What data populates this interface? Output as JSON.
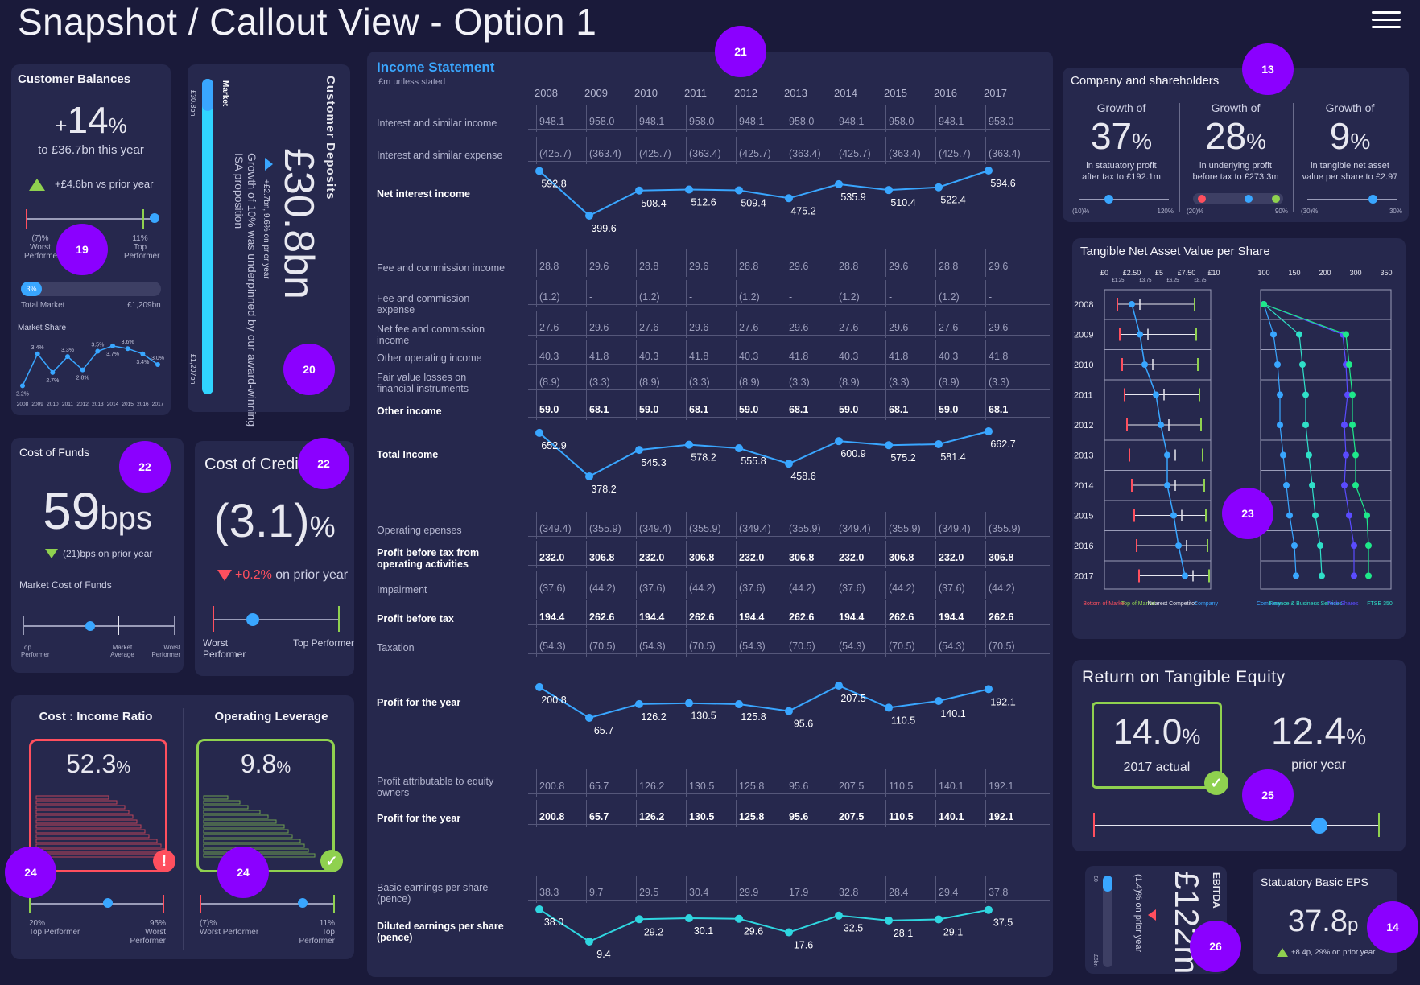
{
  "page": {
    "title": "Snapshot / Callout View - Option 1"
  },
  "markers": {
    "m21": "21",
    "m13": "13",
    "m19": "19",
    "m20": "20",
    "m22a": "22",
    "m22b": "22",
    "m23": "23",
    "m24a": "24",
    "m24b": "24",
    "m25": "25",
    "m26": "26",
    "m14": "14"
  },
  "customer_balances": {
    "title": "Customer Balances",
    "growth_sign": "+",
    "growth_value": "14",
    "growth_unit": "%",
    "subtitle": "to £36.7bn this year",
    "vs_prior": "+£4.6bn vs prior year",
    "gauge_left": "(7)%",
    "gauge_left_label": "Worst Performer",
    "gauge_right": "11%",
    "gauge_right_label": "Top Performer",
    "share_pct": "3%",
    "share_left": "Total Market",
    "share_right": "£1,209bn",
    "market_share_title": "Market Share",
    "market_share": {
      "years": [
        "2008",
        "2009",
        "2010",
        "2011",
        "2012",
        "2013",
        "2014",
        "2015",
        "2016",
        "2017"
      ],
      "values": [
        2.2,
        3.4,
        2.7,
        3.3,
        2.8,
        3.5,
        3.7,
        3.6,
        3.4,
        3.0
      ],
      "labels": [
        "2.2%",
        "3.4%",
        "2.7%",
        "3.3%",
        "2.8%",
        "3.5%",
        "3.7%",
        "3.6%",
        "3.4%",
        "3.0%"
      ]
    }
  },
  "customer_deposits": {
    "title": "Customer Deposits",
    "value": "£30.8bn",
    "change": "+£2.7bn, 9.6% on prior year",
    "narrative": "Growth of 10% was underpinned by our award-winning ISA proposition",
    "bar_label": "Market",
    "bar_top": "£30.8bn",
    "bar_bottom": "£1,207bn"
  },
  "cost_of_funds": {
    "title": "Cost of Funds",
    "value": "59",
    "unit": "bps",
    "change": "(21)bps on prior year",
    "subtitle": "Market Cost of Funds",
    "left_label": "Top Performer",
    "mid_label": "Market Average",
    "right_label": "Worst Performer"
  },
  "cost_of_credit": {
    "title": "Cost of Credit",
    "value": "(3.1)",
    "unit": "%",
    "change_value": "+0.2%",
    "change_text": "on prior year",
    "left_label": "Worst Performer",
    "right_label": "Top Performer"
  },
  "cost_income": {
    "title": "Cost : Income Ratio",
    "value": "52.3",
    "unit": "%",
    "left": "20%",
    "left_label": "Top Performer",
    "right": "95%",
    "right_label": "Worst Performer"
  },
  "operating_leverage": {
    "title": "Operating Leverage",
    "value": "9.8",
    "unit": "%",
    "left": "(7)%",
    "left_label": "Worst Performer",
    "right": "11%",
    "right_label": "Top Performer"
  },
  "income_statement": {
    "title": "Income Statement",
    "subtitle": "£m unless stated",
    "years": [
      "2008",
      "2009",
      "2010",
      "2011",
      "2012",
      "2013",
      "2014",
      "2015",
      "2016",
      "2017"
    ],
    "rows": [
      {
        "label": "Interest and similar income",
        "bold": false,
        "values": [
          "948.1",
          "958.0",
          "948.1",
          "958.0",
          "948.1",
          "958.0",
          "948.1",
          "958.0",
          "948.1",
          "958.0"
        ]
      },
      {
        "label": "Interest and similar expense",
        "bold": false,
        "values": [
          "(425.7)",
          "(363.4)",
          "(425.7)",
          "(363.4)",
          "(425.7)",
          "(363.4)",
          "(425.7)",
          "(363.4)",
          "(425.7)",
          "(363.4)"
        ]
      },
      {
        "label": "Fee and commission income",
        "bold": false,
        "values": [
          "28.8",
          "29.6",
          "28.8",
          "29.6",
          "28.8",
          "29.6",
          "28.8",
          "29.6",
          "28.8",
          "29.6"
        ]
      },
      {
        "label": "Fee and commission expense",
        "bold": false,
        "values": [
          "(1.2)",
          "-",
          "(1.2)",
          "-",
          "(1.2)",
          "-",
          "(1.2)",
          "-",
          "(1.2)",
          "-"
        ]
      },
      {
        "label": "Net fee and commission income",
        "bold": false,
        "values": [
          "27.6",
          "29.6",
          "27.6",
          "29.6",
          "27.6",
          "29.6",
          "27.6",
          "29.6",
          "27.6",
          "29.6"
        ]
      },
      {
        "label": "Other operating income",
        "bold": false,
        "values": [
          "40.3",
          "41.8",
          "40.3",
          "41.8",
          "40.3",
          "41.8",
          "40.3",
          "41.8",
          "40.3",
          "41.8"
        ]
      },
      {
        "label": "Fair value losses on financial instruments",
        "bold": false,
        "values": [
          "(8.9)",
          "(3.3)",
          "(8.9)",
          "(3.3)",
          "(8.9)",
          "(3.3)",
          "(8.9)",
          "(3.3)",
          "(8.9)",
          "(3.3)"
        ]
      },
      {
        "label": "Other income",
        "bold": true,
        "values": [
          "59.0",
          "68.1",
          "59.0",
          "68.1",
          "59.0",
          "68.1",
          "59.0",
          "68.1",
          "59.0",
          "68.1"
        ]
      },
      {
        "label": "Operating epenses",
        "bold": false,
        "values": [
          "(349.4)",
          "(355.9)",
          "(349.4)",
          "(355.9)",
          "(349.4)",
          "(355.9)",
          "(349.4)",
          "(355.9)",
          "(349.4)",
          "(355.9)"
        ]
      },
      {
        "label": "Profit before tax from operating activities",
        "bold": true,
        "values": [
          "232.0",
          "306.8",
          "232.0",
          "306.8",
          "232.0",
          "306.8",
          "232.0",
          "306.8",
          "232.0",
          "306.8"
        ]
      },
      {
        "label": "Impairment",
        "bold": false,
        "values": [
          "(37.6)",
          "(44.2)",
          "(37.6)",
          "(44.2)",
          "(37.6)",
          "(44.2)",
          "(37.6)",
          "(44.2)",
          "(37.6)",
          "(44.2)"
        ]
      },
      {
        "label": "Profit before tax",
        "bold": true,
        "values": [
          "194.4",
          "262.6",
          "194.4",
          "262.6",
          "194.4",
          "262.6",
          "194.4",
          "262.6",
          "194.4",
          "262.6"
        ]
      },
      {
        "label": "Taxation",
        "bold": false,
        "values": [
          "(54.3)",
          "(70.5)",
          "(54.3)",
          "(70.5)",
          "(54.3)",
          "(70.5)",
          "(54.3)",
          "(70.5)",
          "(54.3)",
          "(70.5)"
        ]
      },
      {
        "label": "Profit attributable to equity owners",
        "bold": false,
        "values": [
          "200.8",
          "65.7",
          "126.2",
          "130.5",
          "125.8",
          "95.6",
          "207.5",
          "110.5",
          "140.1",
          "192.1"
        ]
      },
      {
        "label": "Profit for the year",
        "bold": true,
        "values": [
          "200.8",
          "65.7",
          "126.2",
          "130.5",
          "125.8",
          "95.6",
          "207.5",
          "110.5",
          "140.1",
          "192.1"
        ]
      },
      {
        "label": "Basic earnings per share (pence)",
        "bold": false,
        "values": [
          "38.3",
          "9.7",
          "29.5",
          "30.4",
          "29.9",
          "17.9",
          "32.8",
          "28.4",
          "29.4",
          "37.8"
        ]
      }
    ],
    "line_rows": [
      {
        "label": "Net interest income",
        "values": [
          592.8,
          399.6,
          508.4,
          512.6,
          509.4,
          475.2,
          535.9,
          510.4,
          522.4,
          594.6
        ],
        "text": [
          "592.8",
          "399.6",
          "508.4",
          "512.6",
          "509.4",
          "475.2",
          "535.9",
          "510.4",
          "522.4",
          "594.6"
        ],
        "color": "#39a6ff"
      },
      {
        "label": "Total Income",
        "values": [
          652.9,
          378.2,
          545.3,
          578.2,
          555.8,
          458.6,
          600.9,
          575.2,
          581.4,
          662.7
        ],
        "text": [
          "652.9",
          "378.2",
          "545.3",
          "578.2",
          "555.8",
          "458.6",
          "600.9",
          "575.2",
          "581.4",
          "662.7"
        ],
        "color": "#39a6ff"
      },
      {
        "label": "Profit for the year",
        "values": [
          200.8,
          65.7,
          126.2,
          130.5,
          125.8,
          95.6,
          207.5,
          110.5,
          140.1,
          192.1
        ],
        "text": [
          "200.8",
          "65.7",
          "126.2",
          "130.5",
          "125.8",
          "95.6",
          "207.5",
          "110.5",
          "140.1",
          "192.1"
        ],
        "color": "#39a6ff"
      },
      {
        "label": "Diluted earnings per share (pence)",
        "values": [
          38.0,
          9.4,
          29.2,
          30.1,
          29.6,
          17.6,
          32.5,
          28.1,
          29.1,
          37.5
        ],
        "text": [
          "38.0",
          "9.4",
          "29.2",
          "30.1",
          "29.6",
          "17.6",
          "32.5",
          "28.1",
          "29.1",
          "37.5"
        ],
        "color": "#2fd6e0"
      }
    ]
  },
  "company_shareholders": {
    "title": "Company and shareholders",
    "items": [
      {
        "prefix": "Growth of",
        "value": "37",
        "unit": "%",
        "line1": "in statuatory profit",
        "line2": "after tax to £192.1m",
        "left": "(10)%",
        "right": "120%"
      },
      {
        "prefix": "Growth of",
        "value": "28",
        "unit": "%",
        "line1": "in underlying profit",
        "line2": "before tax to £273.3m",
        "left": "(20)%",
        "right": "90%"
      },
      {
        "prefix": "Growth of",
        "value": "9",
        "unit": "%",
        "line1": "in tangible net asset",
        "line2": "value per share to £2.97",
        "left": "(30)%",
        "right": "30%"
      }
    ]
  },
  "tnav": {
    "title": "Tangible Net Asset Value per Share",
    "years": [
      "2008",
      "2009",
      "2010",
      "2011",
      "2012",
      "2013",
      "2014",
      "2015",
      "2016",
      "2017"
    ],
    "left_ticks": [
      "£0",
      "£2.50",
      "£5",
      "£7.50",
      "£10"
    ],
    "left_minor": [
      "£1.25",
      "£3.75",
      "£6.25",
      "£8.75"
    ],
    "right_ticks": [
      "100",
      "150",
      "200",
      "300",
      "350"
    ],
    "left_legend": [
      "Bottom of Market",
      "Top of Market",
      "Nearest Competitor",
      "Company"
    ],
    "right_legend": [
      "Company",
      "Finance & Business Services",
      "Tech Shares",
      "FTSE 350"
    ]
  },
  "rote": {
    "title": "Return on Tangible Equity",
    "actual_value": "14.0",
    "actual_unit": "%",
    "actual_label": "2017 actual",
    "prior_value": "12.4",
    "prior_unit": "%",
    "prior_label": "prior year",
    "gauge_position": 0.79
  },
  "ebitda": {
    "title": "EBITDA",
    "value": "£122m",
    "change": "(1.4)% on prior year",
    "bar_top": "£0",
    "bar_bottom": "£6bn"
  },
  "eps": {
    "title": "Statuatory Basic EPS",
    "value": "37.8",
    "unit": "p",
    "change": "+8.4p, 29% on prior year"
  },
  "colors": {
    "background": "#1a1a3a",
    "panel": "#26284d",
    "accent": "#39a6ff",
    "marker": "#8b00ff",
    "green": "#8fd14f",
    "red": "#ff4f5e"
  }
}
